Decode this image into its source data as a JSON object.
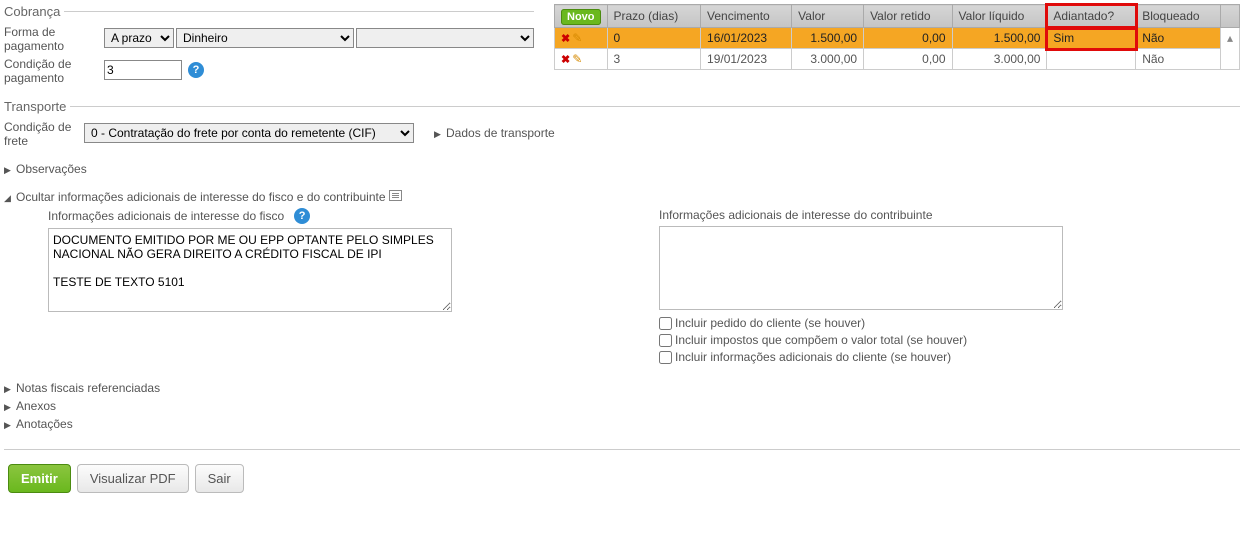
{
  "cobranca": {
    "legend": "Cobrança",
    "forma_label": "Forma de pagamento",
    "forma_sel1": "A prazo",
    "forma_sel2": "Dinheiro",
    "forma_sel3": "",
    "condicao_label": "Condição de pagamento",
    "condicao_valor": "3"
  },
  "grid": {
    "novo": "Novo",
    "headers": {
      "prazo": "Prazo (dias)",
      "vencimento": "Vencimento",
      "valor": "Valor",
      "retido": "Valor retido",
      "liquido": "Valor líquido",
      "adiantado": "Adiantado?",
      "bloqueado": "Bloqueado"
    },
    "rows": [
      {
        "prazo": "0",
        "vencimento": "16/01/2023",
        "valor": "1.500,00",
        "retido": "0,00",
        "liquido": "1.500,00",
        "adiantado": "Sim",
        "bloqueado": "Não",
        "hl": true
      },
      {
        "prazo": "3",
        "vencimento": "19/01/2023",
        "valor": "3.000,00",
        "retido": "0,00",
        "liquido": "3.000,00",
        "adiantado": "",
        "bloqueado": "Não",
        "hl": false
      }
    ]
  },
  "transporte": {
    "legend": "Transporte",
    "condicao_label": "Condição de frete",
    "condicao_val": "0 - Contratação do frete por conta do remetente (CIF)",
    "dados_link": "Dados de transporte"
  },
  "collapse": {
    "obs": "Observações",
    "ocultar": "Ocultar informações adicionais de interesse do fisco e do contribuinte",
    "notas": "Notas fiscais referenciadas",
    "anexos": "Anexos",
    "anot": "Anotações"
  },
  "fisco": {
    "label": "Informações adicionais de interesse do fisco",
    "text": "DOCUMENTO EMITIDO POR ME OU EPP OPTANTE PELO SIMPLES NACIONAL NÃO GERA DIREITO A CRÉDITO FISCAL DE IPI\n\nTESTE DE TEXTO 5101"
  },
  "contrib": {
    "label": "Informações adicionais de interesse do contribuinte",
    "chk1": "Incluir pedido do cliente (se houver)",
    "chk2": "Incluir impostos que compõem o valor total (se houver)",
    "chk3": "Incluir informações adicionais do cliente (se houver)"
  },
  "buttons": {
    "emitir": "Emitir",
    "pdf": "Visualizar PDF",
    "sair": "Sair"
  }
}
